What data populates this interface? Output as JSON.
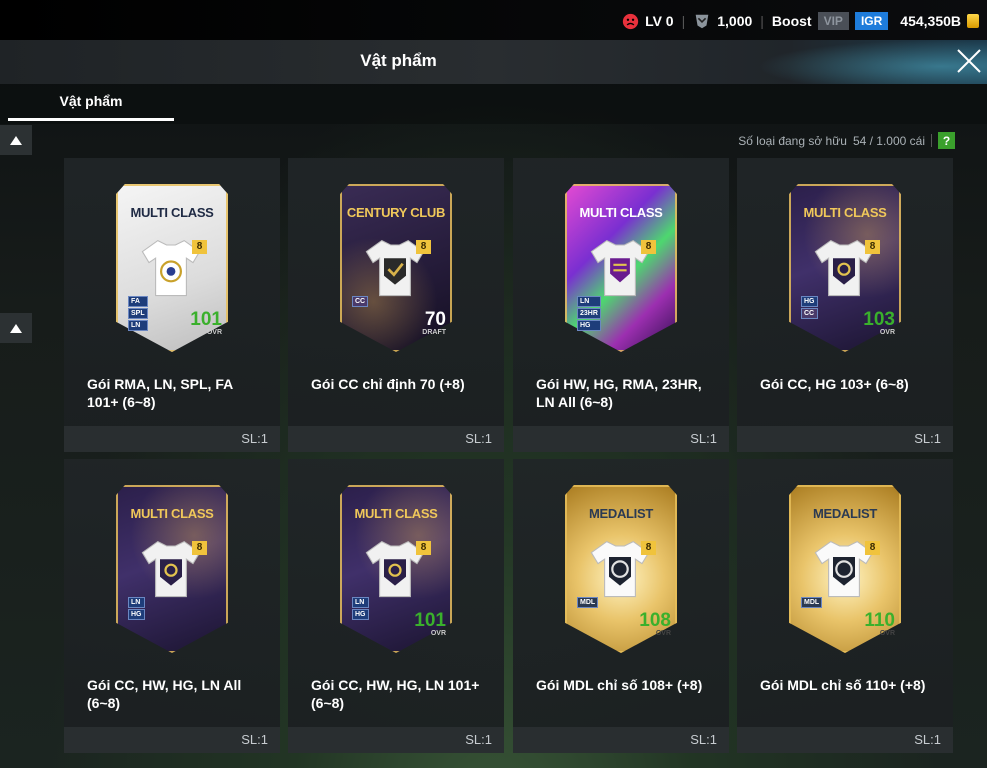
{
  "status": {
    "level": "LV 0",
    "coins": "1,000",
    "boost_label": "Boost",
    "vip_label": "VIP",
    "igr_label": "IGR",
    "bp": "454,350B"
  },
  "header": {
    "title": "Vật phẩm"
  },
  "tabs": [
    {
      "label": "Vật phẩm"
    }
  ],
  "inventory": {
    "count_label": "Số loại đang sở hữu",
    "count_value": "54 / 1.000 cái",
    "help": "?"
  },
  "items": [
    {
      "name": "Gói RMA, LN, SPL, FA 101+ (6~8)",
      "qty": "SL:1",
      "card_title": "MULTI CLASS",
      "level": "8",
      "ovr": "101",
      "ovr_sub": "OVR",
      "tags": [
        "FA",
        "SPL",
        "LN"
      ]
    },
    {
      "name": "Gói CC chỉ định 70 (+8)",
      "qty": "SL:1",
      "card_title": "CENTURY CLUB",
      "level": "8",
      "ovr": "70",
      "ovr_sub": "DRAFT",
      "tags": [
        "CC"
      ]
    },
    {
      "name": "Gói HW, HG, RMA, 23HR, LN All (6~8)",
      "qty": "SL:1",
      "card_title": "MULTI CLASS",
      "level": "8",
      "ovr": "",
      "ovr_sub": "",
      "tags": [
        "LN",
        "23HR",
        "HG"
      ]
    },
    {
      "name": "Gói CC, HG 103+ (6~8)",
      "qty": "SL:1",
      "card_title": "MULTI CLASS",
      "level": "8",
      "ovr": "103",
      "ovr_sub": "OVR",
      "tags": [
        "HG",
        "CC"
      ]
    },
    {
      "name": "Gói CC, HW, HG, LN All (6~8)",
      "qty": "SL:1",
      "card_title": "MULTI CLASS",
      "level": "8",
      "ovr": "",
      "ovr_sub": "",
      "tags": [
        "LN",
        "HG"
      ]
    },
    {
      "name": "Gói CC, HW, HG, LN 101+ (6~8)",
      "qty": "SL:1",
      "card_title": "MULTI CLASS",
      "level": "8",
      "ovr": "101",
      "ovr_sub": "OVR",
      "tags": [
        "LN",
        "HG"
      ]
    },
    {
      "name": "Gói MDL chỉ số 108+ (+8)",
      "qty": "SL:1",
      "card_title": "MEDALIST",
      "level": "8",
      "ovr": "108",
      "ovr_sub": "OVR",
      "tags": [
        "MDL"
      ]
    },
    {
      "name": "Gói MDL chỉ số 110+ (+8)",
      "qty": "SL:1",
      "card_title": "MEDALIST",
      "level": "8",
      "ovr": "110",
      "ovr_sub": "OVR",
      "tags": [
        "MDL"
      ]
    }
  ]
}
